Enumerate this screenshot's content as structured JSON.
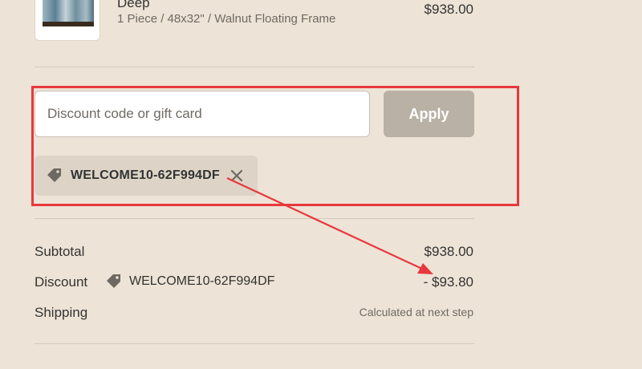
{
  "line_item": {
    "name": "Deep",
    "variant": "1 Piece / 48x32\" / Walnut Floating Frame",
    "price": "$938.00"
  },
  "discount_form": {
    "placeholder": "Discount code or gift card",
    "value": "",
    "apply_label": "Apply"
  },
  "applied_code": {
    "code": "WELCOME10-62F994DF",
    "icon": "tag-icon",
    "remove_icon": "close-icon"
  },
  "summary": {
    "subtotal_label": "Subtotal",
    "subtotal_value": "$938.00",
    "discount_label": "Discount",
    "discount_code": "WELCOME10-62F994DF",
    "discount_value": "- $93.80",
    "shipping_label": "Shipping",
    "shipping_value": "Calculated at next step"
  },
  "annotation": {
    "highlight_color": "#e8383d"
  }
}
